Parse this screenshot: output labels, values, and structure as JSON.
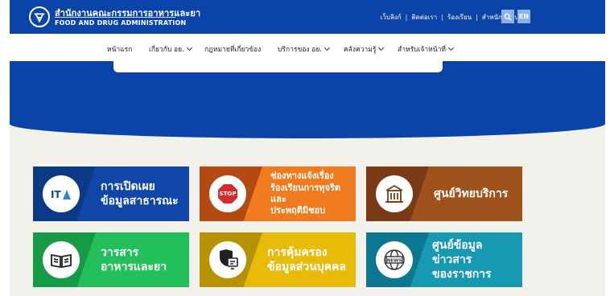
{
  "brand": {
    "name_th": "สำนักงานคณะกรรมการอาหารและยา",
    "name_en": "FOOD AND DRUG ADMINISTRATION"
  },
  "top_links": [
    "เว็บลิงก์",
    "ติดต่อเรา",
    "ร้องเรียน",
    "สำหนักที่พบบ่อย"
  ],
  "lang_button": "EN",
  "nav": [
    {
      "label": "หน้าแรก",
      "dropdown": false
    },
    {
      "label": "เกี่ยวกับ อย.",
      "dropdown": true
    },
    {
      "label": "กฎหมายที่เกี่ยวข้อง",
      "dropdown": false
    },
    {
      "label": "บริการของ อย.",
      "dropdown": true
    },
    {
      "label": "คลังความรู้",
      "dropdown": true
    },
    {
      "label": "สำหรับเจ้าหน้าที่",
      "dropdown": true
    }
  ],
  "cards": [
    {
      "line1": "การเปิดเผย",
      "line2": "ข้อมูลสาธารณะ",
      "icon": "ita-icon",
      "left_color": "#0d3a86",
      "right_color": "#1046a8"
    },
    {
      "line1": "ช่องทางแจ้งเรื่อง",
      "line2": "ร้องเรียนการทุจริตและ",
      "line3": "ประพฤติมิชอบ",
      "icon": "stop-corruption-icon",
      "left_color": "#b24a12",
      "right_color": "#f07a1e"
    },
    {
      "line1": "ศูนย์วิทยบริการ",
      "icon": "building-icon",
      "left_color": "#7a3a14",
      "right_color": "#a0521c"
    },
    {
      "line1": "วารสาร",
      "line2": "อาหารและยา",
      "icon": "book-icon",
      "left_color": "#159a46",
      "right_color": "#22bf5c"
    },
    {
      "line1": "การคุ้มครอง",
      "line2": "ข้อมูลส่วนบุคคล",
      "icon": "privacy-shield-icon",
      "left_color": "#b69200",
      "right_color": "#e8bb08"
    },
    {
      "line1": "ศูนย์ข้อมูลข่าวสาร",
      "line2": "ของราชการ",
      "icon": "news-globe-icon",
      "left_color": "#0c7890",
      "right_color": "#1799b3"
    }
  ],
  "colors": {
    "primary": "#0b44a8",
    "background": "#f3f1ec"
  }
}
